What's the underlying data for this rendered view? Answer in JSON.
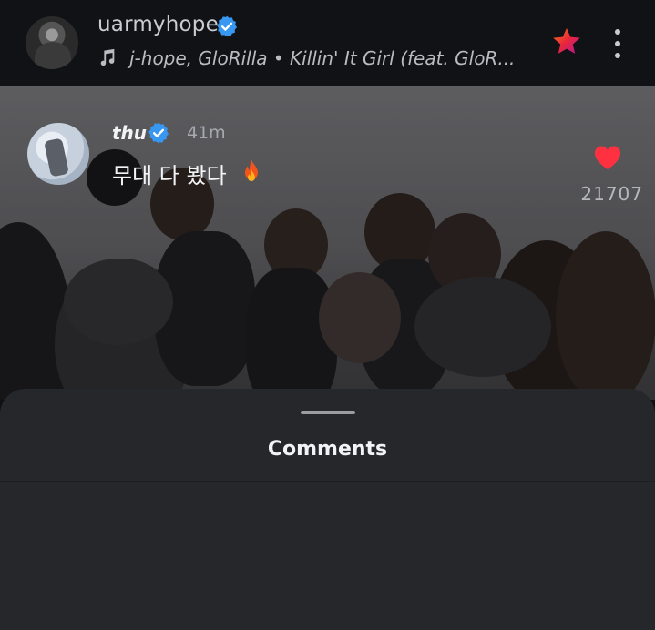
{
  "header": {
    "username": "uarmyhope",
    "track": "j-hope, GloRilla • Killin' It Girl (feat. GloR..."
  },
  "sheet": {
    "title": "Comments"
  },
  "comment": {
    "user": "thu",
    "time": "41m",
    "text": "무대 다 봤다",
    "likes": "21707"
  },
  "colors": {
    "verified": "#3897f0",
    "heart": "#ff3040",
    "sheet_bg": "#25272b"
  },
  "icons": [
    "verified-badge-icon",
    "music-note-icon",
    "star-icon",
    "more-options-icon",
    "fire-emoji-icon",
    "heart-icon"
  ]
}
